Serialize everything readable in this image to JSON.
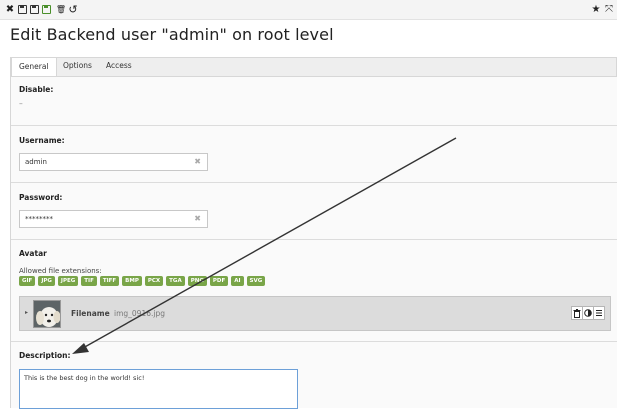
{
  "toolbar": {
    "icons": [
      "close-icon",
      "save-icon",
      "save-and-view-icon",
      "save-and-new-icon",
      "delete-icon",
      "undo-icon",
      "bookmark-icon",
      "fullscreen-icon"
    ],
    "close_glyph": "✖",
    "delete_glyph": "🗑",
    "undo_glyph": "↺",
    "star_glyph": "★",
    "fullscreen_glyph": "⤧"
  },
  "page_title": "Edit Backend user \"admin\" on root level",
  "tabs": [
    {
      "label": "General",
      "active": true
    },
    {
      "label": "Options",
      "active": false
    },
    {
      "label": "Access",
      "active": false
    }
  ],
  "fields": {
    "disable": {
      "label": "Disable:",
      "value": "–"
    },
    "username": {
      "label": "Username:",
      "value": "admin",
      "clear": "✖"
    },
    "password": {
      "label": "Password:",
      "value": "********",
      "clear": "✖"
    },
    "avatar": {
      "label": "Avatar",
      "allowed_label": "Allowed file extensions:",
      "extensions": [
        "GIF",
        "JPG",
        "JPEG",
        "TIF",
        "TIFF",
        "BMP",
        "PCX",
        "TGA",
        "PNG",
        "PDF",
        "AI",
        "SVG"
      ],
      "file": {
        "label": "Filename",
        "name": "img_0916.jpg",
        "caret": "▸",
        "buttons": [
          "delete-icon",
          "toggle-icon",
          "menu-icon"
        ]
      }
    },
    "description": {
      "label": "Description:",
      "value": "This is the best dog in the world! sic!"
    }
  },
  "annotation": {
    "type": "arrow",
    "color": "#333333"
  }
}
